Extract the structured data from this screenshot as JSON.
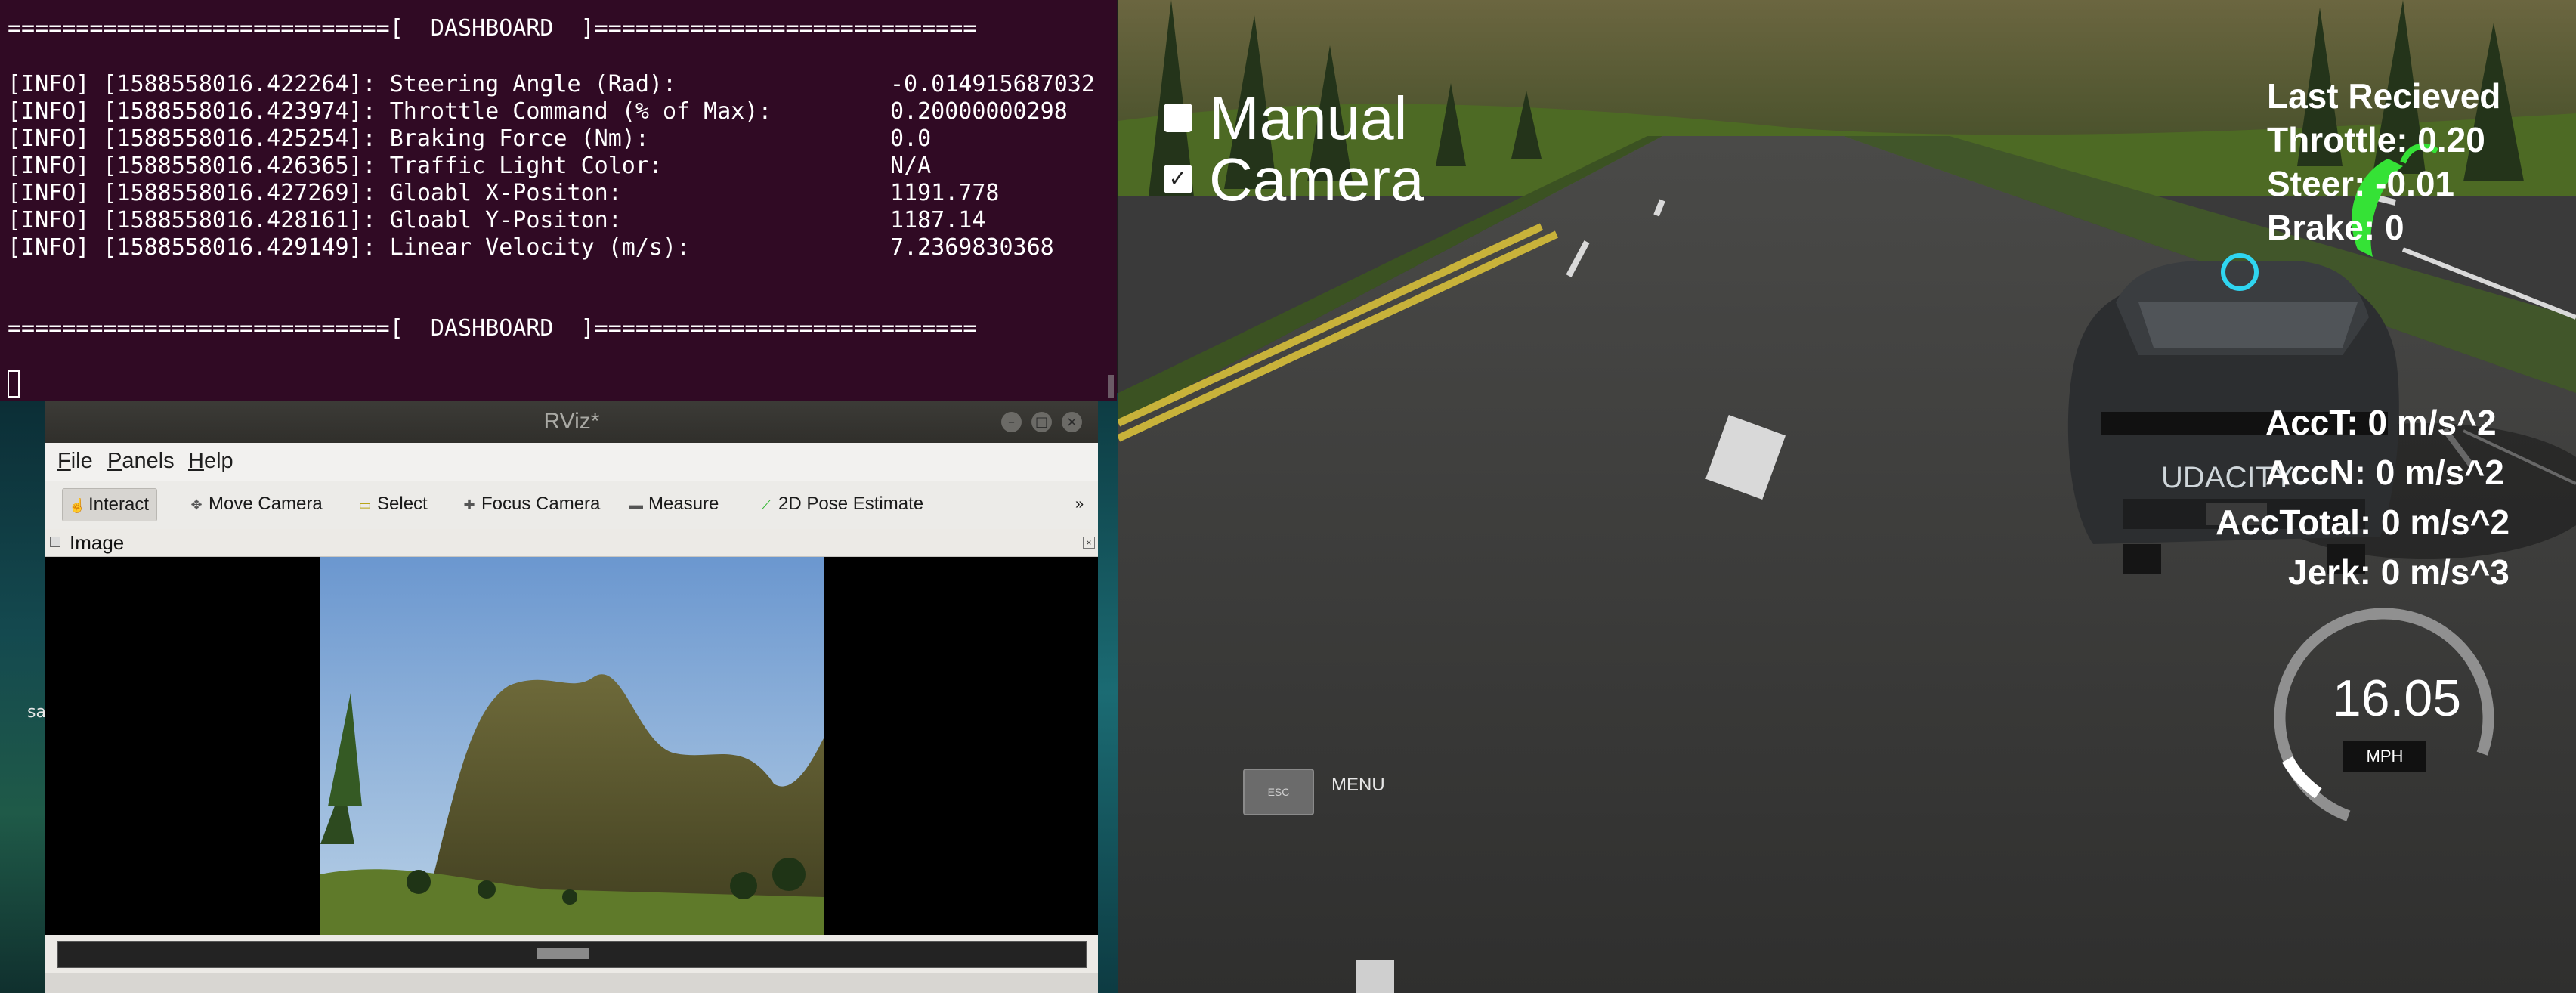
{
  "terminal": {
    "banner_top": "============================[  DASHBOARD  ]============================",
    "banner_bottom": "============================[  DASHBOARD  ]============================",
    "lines": [
      {
        "prefix": "[INFO] [1588558016.422264]: Steering Angle (Rad):",
        "value": "-0.014915687032"
      },
      {
        "prefix": "[INFO] [1588558016.423974]: Throttle Command (% of Max):",
        "value": "0.20000000298"
      },
      {
        "prefix": "[INFO] [1588558016.425254]: Braking Force (Nm):",
        "value": "0.0"
      },
      {
        "prefix": "[INFO] [1588558016.426365]: Traffic Light Color:",
        "value": "N/A"
      },
      {
        "prefix": "[INFO] [1588558016.427269]: Gloabl X-Positon:",
        "value": "1191.778"
      },
      {
        "prefix": "[INFO] [1588558016.428161]: Gloabl Y-Positon:",
        "value": "1187.14"
      },
      {
        "prefix": "[INFO] [1588558016.429149]: Linear Velocity (m/s):",
        "value": "7.2369830368"
      }
    ]
  },
  "desktop": {
    "icon_label_fragment": "sa"
  },
  "rviz": {
    "title": "RViz*",
    "window_buttons": {
      "minimize": "–",
      "maximize": "□",
      "close": "×"
    },
    "menu": [
      {
        "key": "F",
        "rest": "ile"
      },
      {
        "key": "P",
        "rest": "anels"
      },
      {
        "key": "H",
        "rest": "elp"
      }
    ],
    "tools": [
      {
        "label": "Interact",
        "icon": "hand-pointer-icon",
        "glyph": "☝"
      },
      {
        "label": "Move Camera",
        "icon": "move-camera-icon",
        "glyph": "✥"
      },
      {
        "label": "Select",
        "icon": "select-box-icon",
        "glyph": "▭"
      },
      {
        "label": "Focus Camera",
        "icon": "focus-camera-icon",
        "glyph": "✚"
      },
      {
        "label": "Measure",
        "icon": "ruler-icon",
        "glyph": "▬"
      },
      {
        "label": "2D Pose Estimate",
        "icon": "pose-arrow-icon",
        "glyph": "⟋"
      }
    ],
    "toolbar_overflow": "»",
    "image_panel": {
      "title": "Image",
      "close": "×"
    }
  },
  "simulator": {
    "checkboxes": [
      {
        "label": "Manual",
        "checked": false
      },
      {
        "label": "Camera",
        "checked": true
      }
    ],
    "hud_top": [
      "Last Recieved",
      "Throttle: 0.20",
      "Steer: -0.01",
      "Brake: 0"
    ],
    "hud_accel": [
      "AccT: 0 m/s^2",
      "AccN: 0 m/s^2",
      "AccTotal: 0 m/s^2",
      "Jerk: 0 m/s^3"
    ],
    "esc_label": "ESC",
    "menu_label": "MENU",
    "speed": {
      "value": "16.05",
      "unit": "MPH",
      "gauge_fill_fraction": 0.6
    },
    "car_branding": "UDACITY",
    "colors": {
      "trajectory": "#35e236",
      "lane_yellow": "#c8b23a",
      "lane_white": "#d9d9d9"
    }
  }
}
